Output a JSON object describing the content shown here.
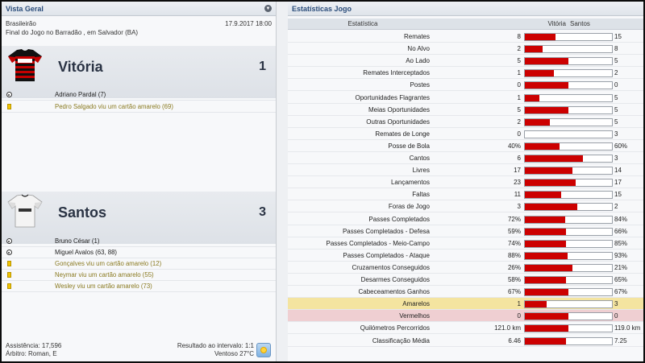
{
  "left_panel": {
    "title": "Vista Geral",
    "competition": "Brasileirão",
    "date": "17.9.2017 18:00",
    "match_status": "Final do Jogo no Barradão , em Salvador (BA)",
    "home": {
      "name": "Vitória",
      "score": "1",
      "events": [
        {
          "type": "goal",
          "text": "Adriano Pardal (7)"
        },
        {
          "type": "card",
          "text": "Pedro Salgado viu um cartão amarelo (69)"
        }
      ]
    },
    "away": {
      "name": "Santos",
      "score": "3",
      "events": [
        {
          "type": "goal",
          "text": "Bruno César (1)"
        },
        {
          "type": "goal",
          "text": "Miguel Avalos (63, 88)"
        },
        {
          "type": "card",
          "text": "Gonçalves viu um cartão amarelo (12)"
        },
        {
          "type": "card",
          "text": "Neymar viu um cartão amarelo (55)"
        },
        {
          "type": "card",
          "text": "Wesley viu um cartão amarelo (73)"
        }
      ]
    },
    "footer": {
      "attendance": "Assistência: 17,596",
      "referee": "Árbitro: Roman, E",
      "halftime": "Resultado ao intervalo: 1:1",
      "weather": "Ventoso 27°C"
    }
  },
  "right_panel": {
    "title": "Estatísticas Jogo",
    "header": {
      "stat": "Estatística",
      "home": "Vitória",
      "away": "Santos"
    },
    "stats": [
      {
        "label": "Remates",
        "home": "8",
        "away": "15",
        "home_share": 0.35
      },
      {
        "label": "No Alvo",
        "home": "2",
        "away": "8",
        "home_share": 0.2
      },
      {
        "label": "Ao Lado",
        "home": "5",
        "away": "5",
        "home_share": 0.5
      },
      {
        "label": "Remates Interceptados",
        "home": "1",
        "away": "2",
        "home_share": 0.33
      },
      {
        "label": "Postes",
        "home": "0",
        "away": "0",
        "home_share": 0.5
      },
      {
        "label": "Oportunidades Flagrantes",
        "home": "1",
        "away": "5",
        "home_share": 0.17
      },
      {
        "label": "Meias Oportunidades",
        "home": "5",
        "away": "5",
        "home_share": 0.5
      },
      {
        "label": "Outras Oportunidades",
        "home": "2",
        "away": "5",
        "home_share": 0.29
      },
      {
        "label": "Remates de Longe",
        "home": "0",
        "away": "3",
        "home_share": 0.0
      },
      {
        "label": "Posse de Bola",
        "home": "40%",
        "away": "60%",
        "home_share": 0.4
      },
      {
        "label": "Cantos",
        "home": "6",
        "away": "3",
        "home_share": 0.67
      },
      {
        "label": "Livres",
        "home": "17",
        "away": "14",
        "home_share": 0.55
      },
      {
        "label": "Lançamentos",
        "home": "23",
        "away": "17",
        "home_share": 0.58
      },
      {
        "label": "Faltas",
        "home": "11",
        "away": "15",
        "home_share": 0.42
      },
      {
        "label": "Foras de Jogo",
        "home": "3",
        "away": "2",
        "home_share": 0.6
      },
      {
        "label": "Passes Completados",
        "home": "72%",
        "away": "84%",
        "home_share": 0.46
      },
      {
        "label": "Passes Completados - Defesa",
        "home": "59%",
        "away": "66%",
        "home_share": 0.47
      },
      {
        "label": "Passes Completados - Meio-Campo",
        "home": "74%",
        "away": "85%",
        "home_share": 0.47
      },
      {
        "label": "Passes Completados - Ataque",
        "home": "88%",
        "away": "93%",
        "home_share": 0.49
      },
      {
        "label": "Cruzamentos Conseguidos",
        "home": "26%",
        "away": "21%",
        "home_share": 0.55
      },
      {
        "label": "Desarmes Conseguidos",
        "home": "58%",
        "away": "65%",
        "home_share": 0.47
      },
      {
        "label": "Cabeceamentos Ganhos",
        "home": "67%",
        "away": "67%",
        "home_share": 0.5
      },
      {
        "label": "Amarelos",
        "home": "1",
        "away": "3",
        "home_share": 0.25,
        "highlight": "yellow"
      },
      {
        "label": "Vermelhos",
        "home": "0",
        "away": "0",
        "home_share": 0.5,
        "highlight": "red"
      },
      {
        "label": "Quilómetros Percorridos",
        "home": "121.0 km",
        "away": "119.0 km",
        "home_share": 0.5
      },
      {
        "label": "Classificação Média",
        "home": "6.46",
        "away": "7.25",
        "home_share": 0.47
      }
    ]
  },
  "colors": {
    "bar_fill": "#cc0000",
    "header_text": "#2a4c7a",
    "card_text": "#8a7a20"
  }
}
